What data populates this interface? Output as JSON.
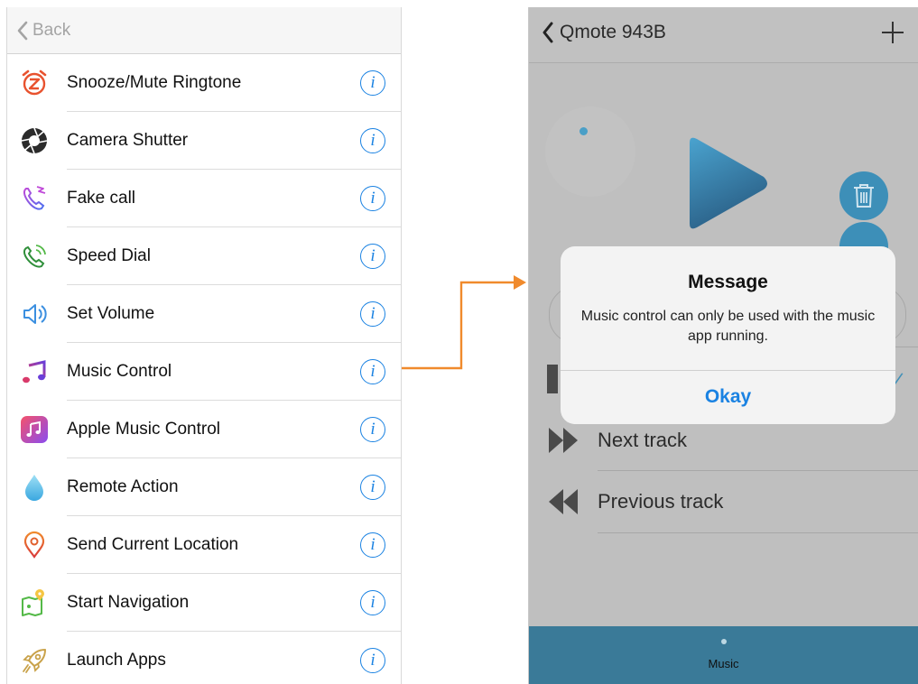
{
  "left_panel": {
    "back_label": "Back",
    "items": [
      {
        "label": "Snooze/Mute Ringtone",
        "icon": "alarm-clock-z-icon"
      },
      {
        "label": "Camera Shutter",
        "icon": "camera-aperture-icon"
      },
      {
        "label": "Fake call",
        "icon": "fake-call-phone-icon"
      },
      {
        "label": "Speed Dial",
        "icon": "speed-dial-phone-icon"
      },
      {
        "label": "Set Volume",
        "icon": "speaker-volume-icon"
      },
      {
        "label": "Music Control",
        "icon": "music-note-icon"
      },
      {
        "label": "Apple Music Control",
        "icon": "apple-music-icon"
      },
      {
        "label": "Remote Action",
        "icon": "water-drop-icon"
      },
      {
        "label": "Send Current Location",
        "icon": "location-pin-icon"
      },
      {
        "label": "Start Navigation",
        "icon": "map-navigation-icon"
      },
      {
        "label": "Launch Apps",
        "icon": "rocket-icon"
      }
    ],
    "info_glyph": "i"
  },
  "right_panel": {
    "title": "Qmote 943B",
    "tracks": [
      {
        "label": "Next track",
        "icon": "fast-forward-icon"
      },
      {
        "label": "Previous track",
        "icon": "rewind-icon"
      }
    ],
    "tab_label": "Music"
  },
  "alert": {
    "title": "Message",
    "message": "Music control can only be used with the music app running.",
    "button": "Okay"
  },
  "colors": {
    "accent_blue": "#1a82e2",
    "connector_orange": "#f08a2c",
    "tab_blue": "#3a7a98"
  }
}
